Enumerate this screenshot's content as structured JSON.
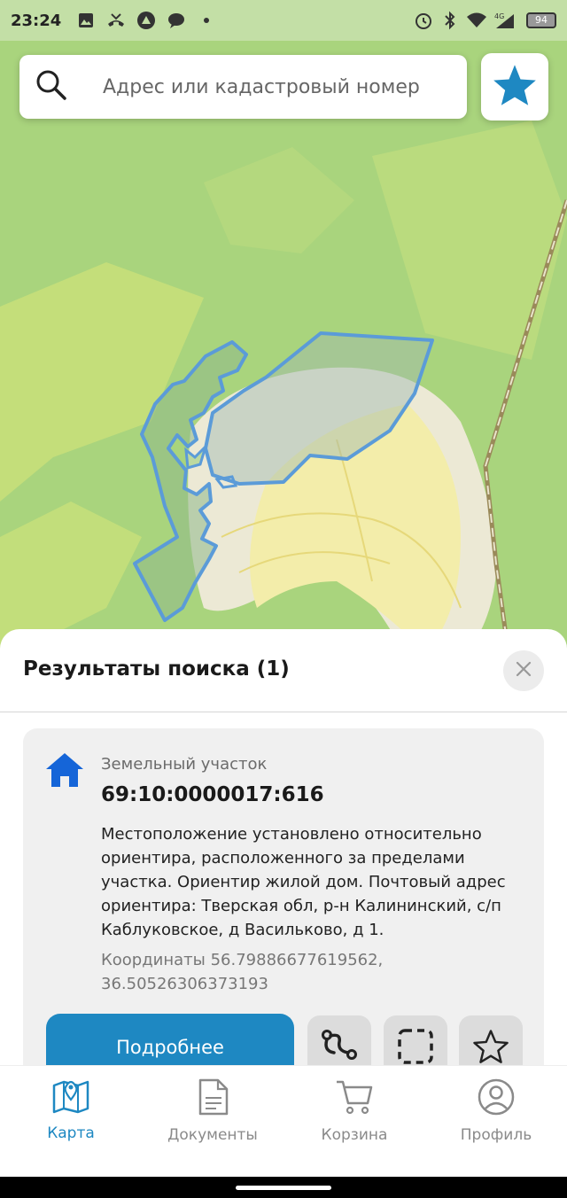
{
  "status_bar": {
    "time": "23:24",
    "battery": "94",
    "network": "4G",
    "icons": [
      "image-icon",
      "missed-call-icon",
      "app-icon",
      "chat-icon",
      "dot-icon",
      "alarm-icon",
      "bluetooth-icon",
      "wifi-icon",
      "signal-icon",
      "battery-icon"
    ]
  },
  "search": {
    "placeholder": "Адрес или кадастровый номер"
  },
  "results": {
    "title": "Результаты поиска (1)"
  },
  "card": {
    "type": "Земельный участок",
    "number": "69:10:0000017:616",
    "description": "Местоположение установлено относительно ориентира, расположенного за пределами участка. Ориентир жилой дом. Почтовый адрес ориентира: Тверская обл, р-н Калининский, с/п Каблуковское, д Васильково, д 1.",
    "coordinates": "Координаты 56.79886677619562, 36.50526306373193",
    "details_label": "Подробнее"
  },
  "nav": {
    "items": [
      {
        "label": "Карта",
        "active": true
      },
      {
        "label": "Документы",
        "active": false
      },
      {
        "label": "Корзина",
        "active": false
      },
      {
        "label": "Профиль",
        "active": false
      }
    ]
  },
  "colors": {
    "accent": "#1e88c2",
    "map_green": "#a9d47d",
    "map_yellow": "#f2ecaa",
    "parcel_outline": "#5b9bd8"
  }
}
